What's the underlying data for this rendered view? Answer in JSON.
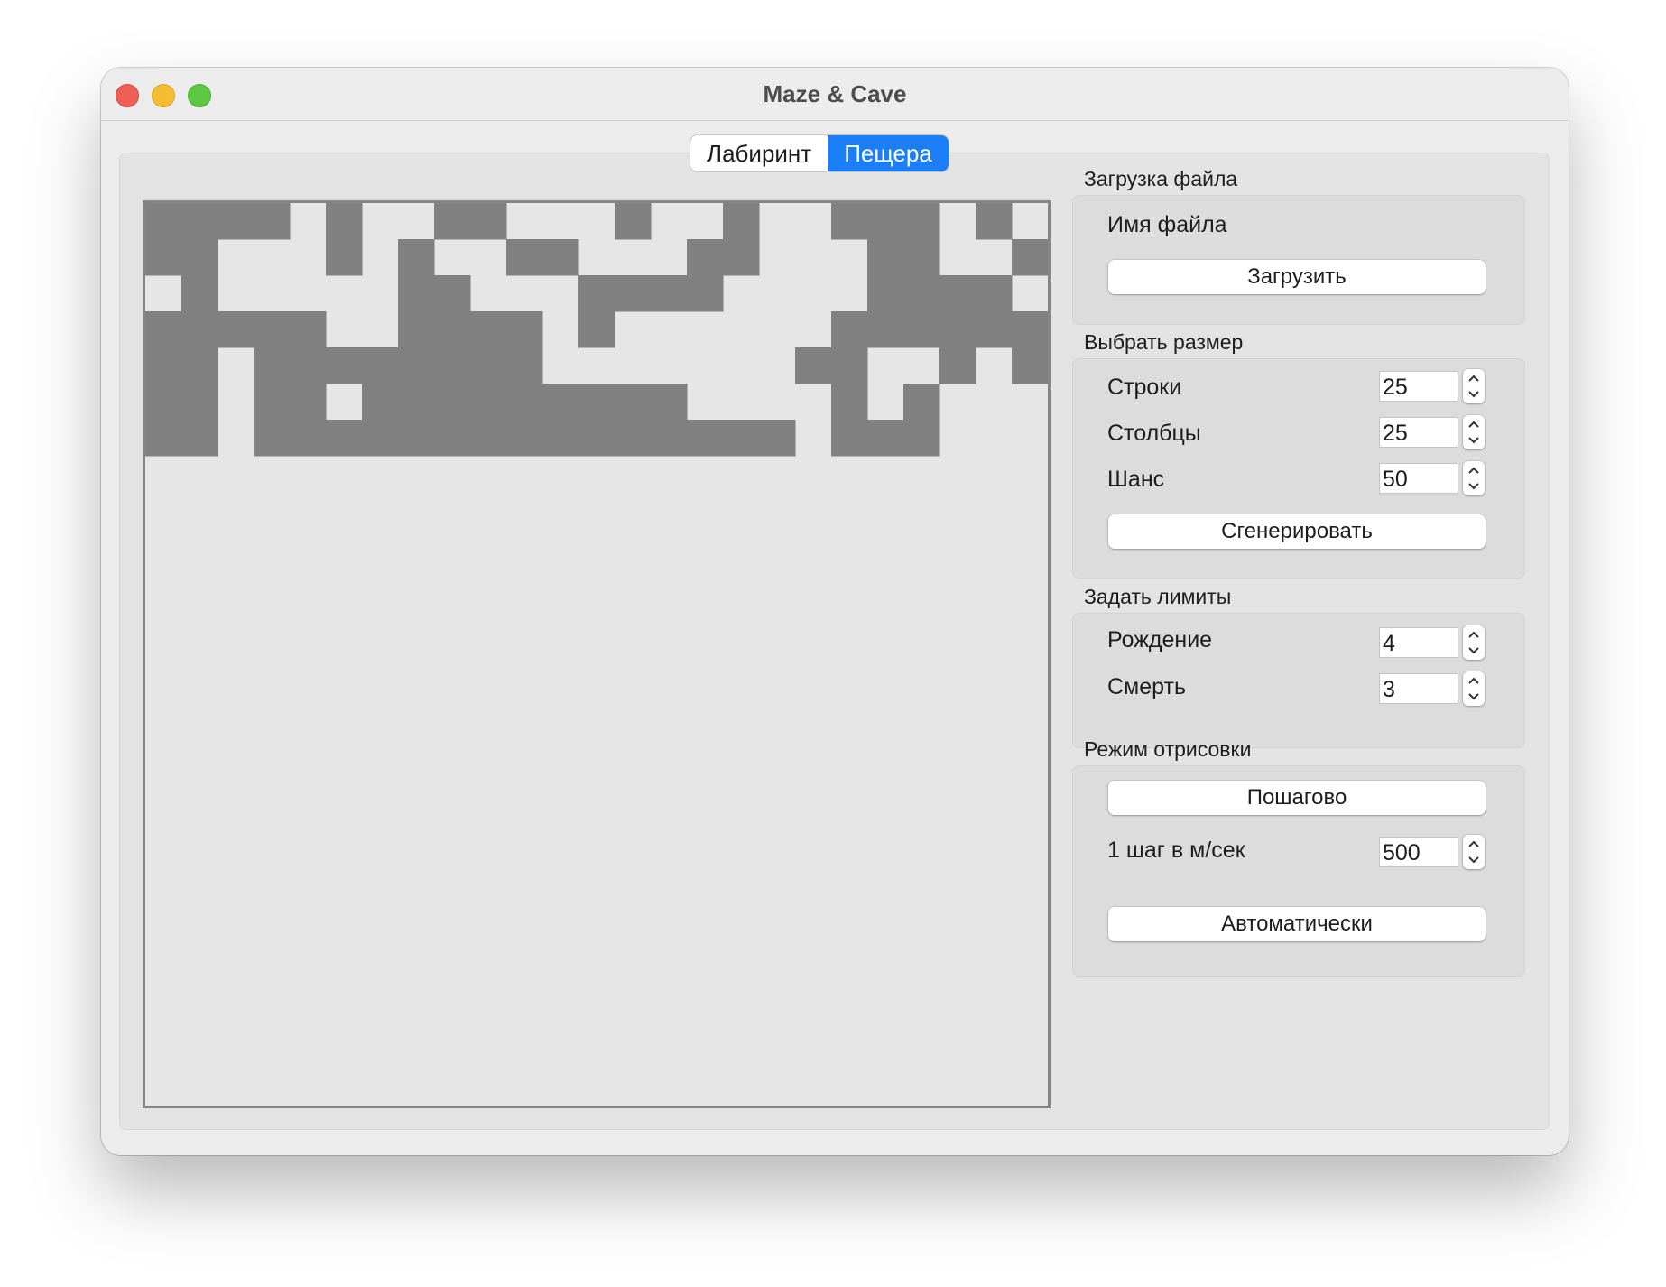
{
  "window": {
    "title": "Maze & Cave"
  },
  "tabs": [
    {
      "label": "Лабиринт",
      "active": false
    },
    {
      "label": "Пещера",
      "active": true
    }
  ],
  "cave": {
    "rows": 25,
    "cols": 25,
    "wall_color": "#808080",
    "empty_color": "#e6e6e6",
    "grid": [
      "1111010011000100100111010",
      "1100010100110001100011001",
      "0100000110001111000011110",
      "1111100111101000000111111",
      "1101111111100000001100101",
      "1101101111111110000101000",
      "1101111111111111110111000",
      "0000000000000000000000000",
      "0000000000000000000000000",
      "0000000000000000000000000",
      "0000000000000000000000000",
      "0000000000000000000000000",
      "0000000000000000000000000",
      "0000000000000000000000000",
      "0000000000000000000000000",
      "0000000000000000000000000",
      "0000000000000000000000000",
      "0000000000000000000000000",
      "0000000000000000000000000",
      "0000000000000000000000000",
      "0000000000000000000000000",
      "0000000000000000000000000",
      "0000000000000000000000000",
      "0000000000000000000000000",
      "0000000000000000000000000"
    ]
  },
  "file_section": {
    "title": "Загрузка файла",
    "filename_label": "Имя файла",
    "load_button": "Загрузить"
  },
  "size_section": {
    "title": "Выбрать размер",
    "rows_label": "Строки",
    "rows_value": "25",
    "cols_label": "Столбцы",
    "cols_value": "25",
    "chance_label": "Шанс",
    "chance_value": "50",
    "generate_button": "Сгенерировать"
  },
  "limits_section": {
    "title": "Задать лимиты",
    "birth_label": "Рождение",
    "birth_value": "4",
    "death_label": "Смерть",
    "death_value": "3"
  },
  "render_section": {
    "title": "Режим отрисовки",
    "step_button": "Пошагово",
    "step_ms_label": "1 шаг в м/сек",
    "step_ms_value": "500",
    "auto_button": "Автоматически"
  }
}
